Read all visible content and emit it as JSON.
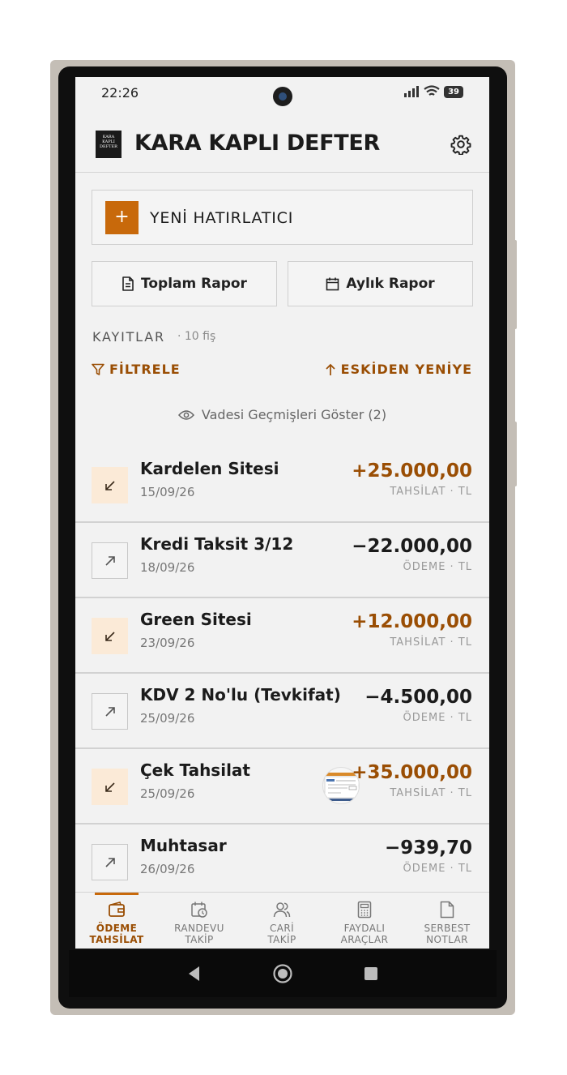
{
  "status_bar": {
    "time": "22:26",
    "battery": "39"
  },
  "header": {
    "logo_text": "KARA KAPLI DEFTER",
    "title": "KARA KAPLI DEFTER"
  },
  "reminder": {
    "plus": "+",
    "label": "YENİ HATIRLATICI"
  },
  "reports": {
    "total": "Toplam Rapor",
    "monthly": "Aylık Rapor"
  },
  "records": {
    "title": "KAYITLAR",
    "count": "· 10 fiş",
    "filter_label": "FİLTRELE",
    "sort_label": "ESKİDEN YENİYE",
    "overdue_label": "Vadesi Geçmişleri Göster (2)"
  },
  "entries": [
    {
      "name": "Kardelen Sitesi",
      "date": "15/09/26",
      "amount": "+25.000,00",
      "kind": "TAHSİLAT · TL",
      "direction": "in"
    },
    {
      "name": "Kredi Taksit 3/12",
      "date": "18/09/26",
      "amount": "−22.000,00",
      "kind": "ÖDEME · TL",
      "direction": "out"
    },
    {
      "name": "Green Sitesi",
      "date": "23/09/26",
      "amount": "+12.000,00",
      "kind": "TAHSİLAT · TL",
      "direction": "in"
    },
    {
      "name": "KDV 2 No'lu (Tevkifat)",
      "date": "25/09/26",
      "amount": "−4.500,00",
      "kind": "ÖDEME · TL",
      "direction": "out"
    },
    {
      "name": "Çek Tahsilat",
      "date": "25/09/26",
      "amount": "+35.000,00",
      "kind": "TAHSİLAT · TL",
      "direction": "in",
      "has_attachment": true
    },
    {
      "name": "Muhtasar",
      "date": "26/09/26",
      "amount": "−939,70",
      "kind": "ÖDEME · TL",
      "direction": "out"
    }
  ],
  "bottom_nav": [
    {
      "line1": "ÖDEME",
      "line2": "TAHSİLAT",
      "icon": "wallet-icon",
      "active": true
    },
    {
      "line1": "RANDEVU",
      "line2": "TAKİP",
      "icon": "calendar-clock-icon",
      "active": false
    },
    {
      "line1": "CARİ",
      "line2": "TAKİP",
      "icon": "users-icon",
      "active": false
    },
    {
      "line1": "FAYDALI",
      "line2": "ARAÇLAR",
      "icon": "calculator-icon",
      "active": false
    },
    {
      "line1": "SERBEST",
      "line2": "NOTLAR",
      "icon": "note-icon",
      "active": false
    }
  ],
  "colors": {
    "accent": "#c8690b",
    "accent_text": "#9a4e04",
    "income_bg": "#fbead7",
    "background": "#f2f2f2"
  }
}
